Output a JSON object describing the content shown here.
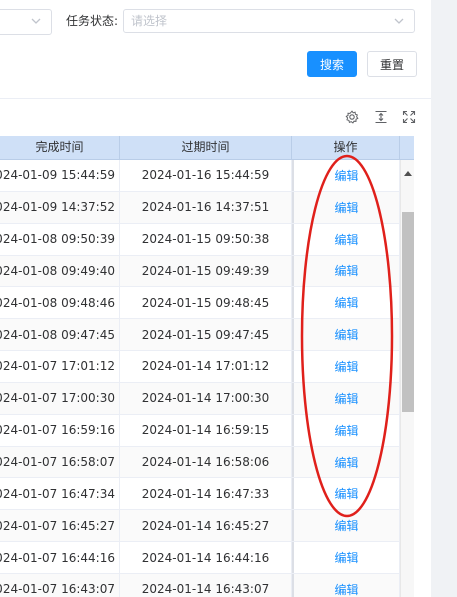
{
  "filter": {
    "status_label": "任务状态:",
    "status_placeholder": "请选择",
    "search_label": "搜索",
    "reset_label": "重置"
  },
  "toolbar": {
    "icons": [
      "settings-icon",
      "vertical-height-icon",
      "fullscreen-icon"
    ]
  },
  "table": {
    "headers": {
      "completed_time": "完成时间",
      "expire_time": "过期时间",
      "actions": "操作"
    },
    "rows": [
      {
        "completed": "2024-01-09 15:44:59",
        "expire": "2024-01-16 15:44:59",
        "action": "编辑"
      },
      {
        "completed": "2024-01-09 14:37:52",
        "expire": "2024-01-16 14:37:51",
        "action": "编辑"
      },
      {
        "completed": "2024-01-08 09:50:39",
        "expire": "2024-01-15 09:50:38",
        "action": "编辑"
      },
      {
        "completed": "2024-01-08 09:49:40",
        "expire": "2024-01-15 09:49:39",
        "action": "编辑"
      },
      {
        "completed": "2024-01-08 09:48:46",
        "expire": "2024-01-15 09:48:45",
        "action": "编辑"
      },
      {
        "completed": "2024-01-08 09:47:45",
        "expire": "2024-01-15 09:47:45",
        "action": "编辑"
      },
      {
        "completed": "2024-01-07 17:01:12",
        "expire": "2024-01-14 17:01:12",
        "action": "编辑"
      },
      {
        "completed": "2024-01-07 17:00:30",
        "expire": "2024-01-14 17:00:30",
        "action": "编辑"
      },
      {
        "completed": "2024-01-07 16:59:16",
        "expire": "2024-01-14 16:59:15",
        "action": "编辑"
      },
      {
        "completed": "2024-01-07 16:58:07",
        "expire": "2024-01-14 16:58:06",
        "action": "编辑"
      },
      {
        "completed": "2024-01-07 16:47:34",
        "expire": "2024-01-14 16:47:33",
        "action": "编辑"
      },
      {
        "completed": "2024-01-07 16:45:27",
        "expire": "2024-01-14 16:45:27",
        "action": "编辑"
      },
      {
        "completed": "2024-01-07 16:44:16",
        "expire": "2024-01-14 16:44:16",
        "action": "编辑"
      },
      {
        "completed": "2024-01-07 16:43:07",
        "expire": "2024-01-14 16:43:07",
        "action": "编辑"
      }
    ]
  },
  "colors": {
    "primary": "#1890ff",
    "header_bg": "#cfe0f7",
    "annotation_red": "#e0201b"
  }
}
